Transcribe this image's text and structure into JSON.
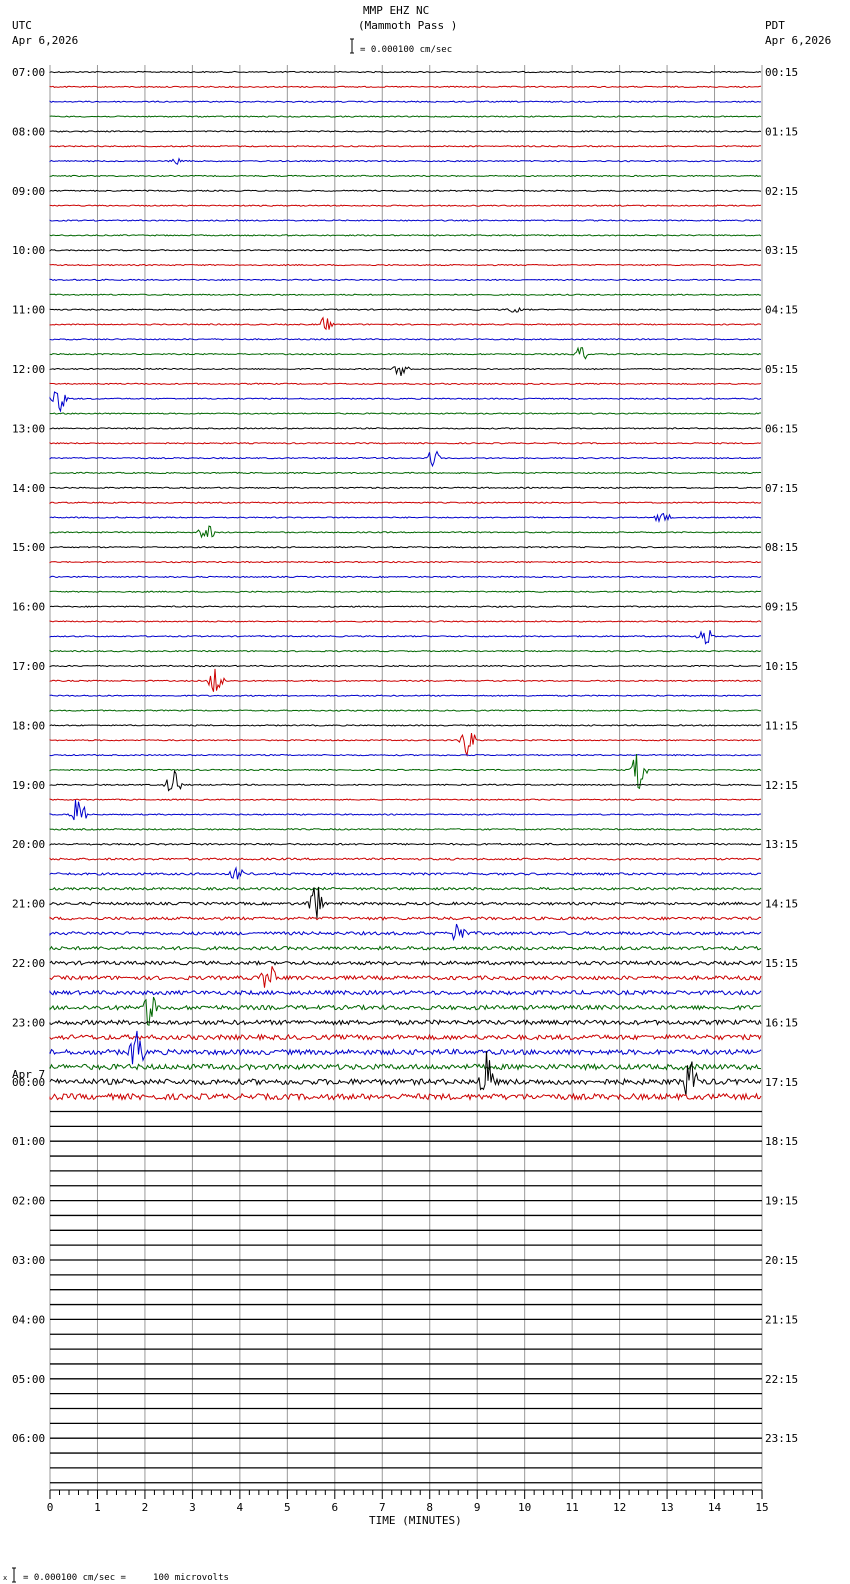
{
  "header": {
    "title": "MMP EHZ NC",
    "subtitle": "(Mammoth Pass )",
    "left_tz": "UTC",
    "left_date": "Apr 6,2026",
    "right_tz": "PDT",
    "right_date": "Apr 6,2026",
    "scale_text": "= 0.000100 cm/sec"
  },
  "footer": {
    "scale_text": "= 0.000100 cm/sec =     100 microvolts"
  },
  "chart_data": {
    "type": "line",
    "title": "MMP EHZ NC (Mammoth Pass )",
    "xlabel": "TIME (MINUTES)",
    "xlim": [
      0,
      15
    ],
    "x_ticks": [
      "0",
      "1",
      "2",
      "3",
      "4",
      "5",
      "6",
      "7",
      "8",
      "9",
      "10",
      "11",
      "12",
      "13",
      "14",
      "15"
    ],
    "rows_total": 96,
    "rows_with_data": 70,
    "trace_colors": [
      "#000000",
      "#cc0000",
      "#0000cc",
      "#006600"
    ],
    "left_labels": [
      "07:00",
      "08:00",
      "09:00",
      "10:00",
      "11:00",
      "12:00",
      "13:00",
      "14:00",
      "15:00",
      "16:00",
      "17:00",
      "18:00",
      "19:00",
      "20:00",
      "21:00",
      "22:00",
      "23:00",
      "00:00",
      "01:00",
      "02:00",
      "03:00",
      "04:00",
      "05:00",
      "06:00"
    ],
    "day_change_label": "Apr 7",
    "right_labels": [
      "00:15",
      "01:15",
      "02:15",
      "03:15",
      "04:15",
      "05:15",
      "06:15",
      "07:15",
      "08:15",
      "09:15",
      "10:15",
      "11:15",
      "12:15",
      "13:15",
      "14:15",
      "15:15",
      "16:15",
      "17:15",
      "18:15",
      "19:15",
      "20:15",
      "21:15",
      "22:15",
      "23:15"
    ],
    "events": [
      {
        "row": 6,
        "minute": 2.7,
        "amp": 4
      },
      {
        "row": 16,
        "minute": 9.8,
        "amp": 4
      },
      {
        "row": 17,
        "minute": 5.8,
        "amp": 8
      },
      {
        "row": 19,
        "minute": 11.2,
        "amp": 10
      },
      {
        "row": 20,
        "minute": 7.4,
        "amp": 10
      },
      {
        "row": 22,
        "minute": 0.2,
        "amp": 14
      },
      {
        "row": 26,
        "minute": 8.1,
        "amp": 12
      },
      {
        "row": 30,
        "minute": 12.9,
        "amp": 8
      },
      {
        "row": 31,
        "minute": 3.3,
        "amp": 14
      },
      {
        "row": 38,
        "minute": 13.8,
        "amp": 14
      },
      {
        "row": 41,
        "minute": 3.5,
        "amp": 18
      },
      {
        "row": 45,
        "minute": 8.8,
        "amp": 18
      },
      {
        "row": 47,
        "minute": 12.4,
        "amp": 24
      },
      {
        "row": 48,
        "minute": 2.6,
        "amp": 16
      },
      {
        "row": 50,
        "minute": 0.6,
        "amp": 22
      },
      {
        "row": 54,
        "minute": 3.9,
        "amp": 12
      },
      {
        "row": 56,
        "minute": 5.6,
        "amp": 22
      },
      {
        "row": 58,
        "minute": 8.6,
        "amp": 14
      },
      {
        "row": 61,
        "minute": 4.6,
        "amp": 18
      },
      {
        "row": 63,
        "minute": 2.1,
        "amp": 22
      },
      {
        "row": 66,
        "minute": 1.8,
        "amp": 30
      },
      {
        "row": 68,
        "minute": 9.2,
        "amp": 30
      },
      {
        "row": 68,
        "minute": 13.5,
        "amp": 24
      }
    ]
  }
}
